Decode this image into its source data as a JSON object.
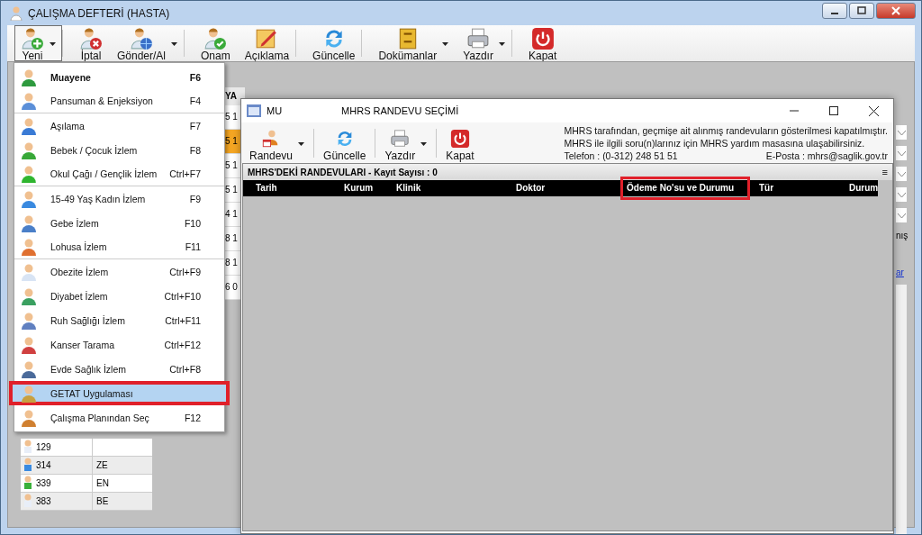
{
  "window": {
    "title": "ÇALIŞMA DEFTERİ (HASTA)"
  },
  "toolbar": [
    {
      "label": "Yeni",
      "dropdown": true,
      "pressed": true,
      "separator_after": true
    },
    {
      "label": "İptal",
      "dropdown": false,
      "pressed": false,
      "separator_after": false
    },
    {
      "label": "Gönder/Al",
      "dropdown": true,
      "pressed": false,
      "separator_after": true
    },
    {
      "label": "Onam",
      "dropdown": false,
      "pressed": false,
      "separator_after": false
    },
    {
      "label": "Açıklama",
      "dropdown": false,
      "pressed": false,
      "separator_after": true
    },
    {
      "label": "Güncelle",
      "dropdown": false,
      "pressed": false,
      "separator_after": true
    },
    {
      "label": "Dokümanlar",
      "dropdown": true,
      "pressed": false,
      "separator_after": false
    },
    {
      "label": "Yazdır",
      "dropdown": true,
      "pressed": false,
      "separator_after": true
    },
    {
      "label": "Kapat",
      "dropdown": false,
      "pressed": false,
      "separator_after": false
    }
  ],
  "background": {
    "grid_header": "YA",
    "grid_cells": [
      {
        "text": "5 1",
        "selected": false
      },
      {
        "text": "5 1",
        "selected": true
      },
      {
        "text": "5 1",
        "selected": false
      },
      {
        "text": "5 1",
        "selected": false
      },
      {
        "text": "4 1",
        "selected": false
      },
      {
        "text": "8 1",
        "selected": false
      },
      {
        "text": "8 1",
        "selected": false
      },
      {
        "text": "6 0",
        "selected": false
      }
    ],
    "patients": [
      {
        "id": "129"
      },
      {
        "id": "314",
        "name": "ZE"
      },
      {
        "id": "339",
        "name": "EN"
      },
      {
        "id": "383",
        "name": "BE"
      }
    ],
    "right_label": "nış",
    "right_link": "ar"
  },
  "dialog": {
    "icon_label": "MU",
    "title": "MHRS RANDEVU SEÇİMİ",
    "toolbar": [
      {
        "label": "Randevu",
        "dropdown": true
      },
      {
        "label": "Güncelle",
        "dropdown": false
      },
      {
        "label": "Yazdır",
        "dropdown": true
      },
      {
        "label": "Kapat",
        "dropdown": false
      }
    ],
    "info_lines": [
      "MHRS tarafından, geçmişe ait alınmış randevuların gösterilmesi kapatılmıştır.",
      "MHRS ile ilgili soru(n)larınız için MHRS yardım masasına ulaşabilirsiniz."
    ],
    "phone": "Telefon : (0-312) 248 51 51",
    "email": "E-Posta : mhrs@saglik.gov.tr",
    "grid_title": "MHRS'DEKİ RANDEVULARI - Kayıt Sayısı : 0",
    "grid_menu": "≡",
    "columns": [
      {
        "label": "Tarih",
        "highlighted": false
      },
      {
        "label": "Kurum",
        "highlighted": false
      },
      {
        "label": "Klinik",
        "highlighted": false
      },
      {
        "label": "Doktor",
        "highlighted": false
      },
      {
        "label": "Ödeme No'su ve Durumu",
        "highlighted": true
      },
      {
        "label": "Tür",
        "highlighted": false
      },
      {
        "label": "Durum",
        "highlighted": false
      }
    ]
  },
  "menu": [
    {
      "label": "Muayene",
      "shortcut": "F6",
      "bold": true,
      "selected": false,
      "highlighted": false,
      "separator_after": false
    },
    {
      "label": "Pansuman & Enjeksiyon",
      "shortcut": "F4",
      "bold": false,
      "selected": false,
      "highlighted": false,
      "separator_after": true
    },
    {
      "label": "Aşılama",
      "shortcut": "F7",
      "bold": false,
      "selected": false,
      "highlighted": false,
      "separator_after": false
    },
    {
      "label": "Bebek / Çocuk İzlem",
      "shortcut": "F8",
      "bold": false,
      "selected": false,
      "highlighted": false,
      "separator_after": false
    },
    {
      "label": "Okul Çağı / Gençlik İzlem",
      "shortcut": "Ctrl+F7",
      "bold": false,
      "selected": false,
      "highlighted": false,
      "separator_after": true
    },
    {
      "label": "15-49 Yaş Kadın İzlem",
      "shortcut": "F9",
      "bold": false,
      "selected": false,
      "highlighted": false,
      "separator_after": false
    },
    {
      "label": "Gebe İzlem",
      "shortcut": "F10",
      "bold": false,
      "selected": false,
      "highlighted": false,
      "separator_after": false
    },
    {
      "label": "Lohusa İzlem",
      "shortcut": "F11",
      "bold": false,
      "selected": false,
      "highlighted": false,
      "separator_after": true
    },
    {
      "label": "Obezite İzlem",
      "shortcut": "Ctrl+F9",
      "bold": false,
      "selected": false,
      "highlighted": false,
      "separator_after": false
    },
    {
      "label": "Diyabet İzlem",
      "shortcut": "Ctrl+F10",
      "bold": false,
      "selected": false,
      "highlighted": false,
      "separator_after": false
    },
    {
      "label": "Ruh Sağlığı İzlem",
      "shortcut": "Ctrl+F11",
      "bold": false,
      "selected": false,
      "highlighted": false,
      "separator_after": false
    },
    {
      "label": "Kanser Tarama",
      "shortcut": "Ctrl+F12",
      "bold": false,
      "selected": false,
      "highlighted": false,
      "separator_after": false
    },
    {
      "label": "Evde Sağlık İzlem",
      "shortcut": "Ctrl+F8",
      "bold": false,
      "selected": false,
      "highlighted": false,
      "separator_after": false
    },
    {
      "label": "GETAT Uygulaması",
      "bold": false,
      "selected": true,
      "highlighted": true,
      "separator_after": false
    },
    {
      "label": "Çalışma Planından Seç",
      "shortcut": "F12",
      "bold": false,
      "selected": false,
      "highlighted": false,
      "separator_after": false
    }
  ]
}
